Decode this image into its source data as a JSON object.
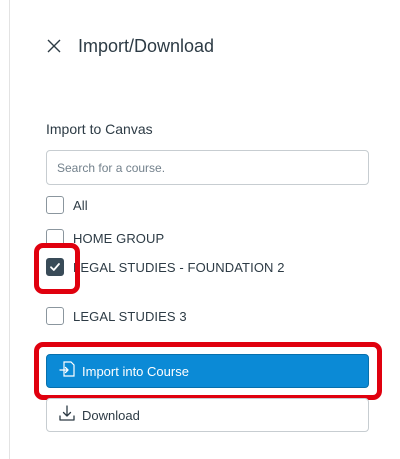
{
  "tray": {
    "title": "Import/Download",
    "close_icon": "close-icon"
  },
  "import": {
    "section_label": "Import to Canvas",
    "search_placeholder": "Search for a course.",
    "options": [
      {
        "label": "All",
        "checked": false
      },
      {
        "label": "HOME GROUP",
        "checked": false
      },
      {
        "label": "LEGAL STUDIES - FOUNDATION 2",
        "checked": true
      },
      {
        "label": "LEGAL STUDIES 3",
        "checked": false
      }
    ],
    "import_button_label": "Import into Course",
    "import_button_icon": "import-icon",
    "download_button_label": "Download",
    "download_button_icon": "download-icon"
  },
  "colors": {
    "primary_button": "#0b8ad6",
    "checked_box": "#394b58",
    "annotation_highlight": "#e0000e",
    "text": "#2d3b45"
  }
}
